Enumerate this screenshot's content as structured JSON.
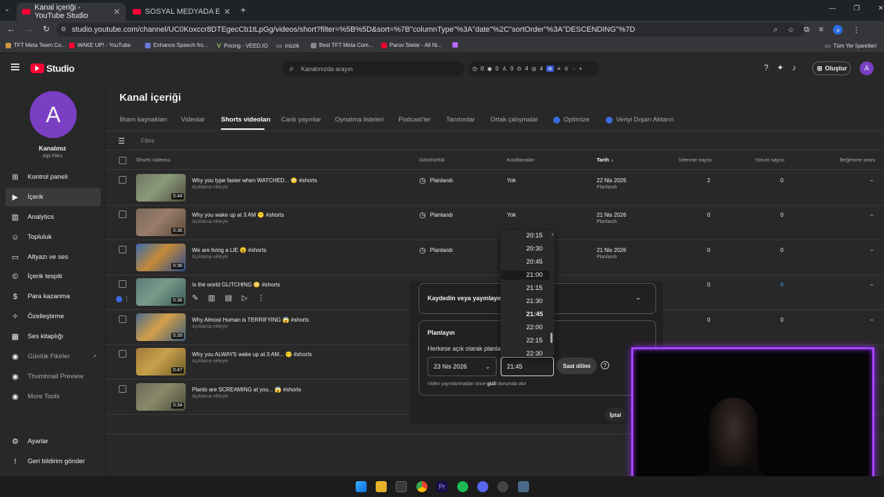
{
  "browser": {
    "tabs": [
      {
        "title": "Kanal içeriği - YouTube Studio"
      },
      {
        "title": "SOSYAL MEDYADA ERKEK OLM..."
      }
    ],
    "url": "studio.youtube.com/channel/UC0Koxccr8DTEgecCb1tLpGg/videos/short?filter=%5B%5D&sort=%7B\"columnType\"%3A\"date\"%2C\"sortOrder\"%3A\"DESCENDING\"%7D",
    "bookmarks": [
      "TFT Meta Team Co...",
      "WAKE UP! - YouTube",
      "Enhance Speech fro...",
      "Pricing - VEED.IO",
      "müzik",
      "Best TFT Meta Com...",
      "Parov Stelar - All Ni..."
    ],
    "all_bookmarks": "Tüm Yer İşaretleri"
  },
  "studio": {
    "logo": "Studio",
    "search_placeholder": "Kanalınızda arayın",
    "create_label": "Oluştur",
    "stats": [
      "0",
      "0",
      "0",
      "4",
      "4"
    ],
    "avatar_letter": "A"
  },
  "channel": {
    "letter": "A",
    "name": "Kanalınız",
    "handle": "Alpi Files"
  },
  "nav": [
    {
      "label": "Kontrol paneli",
      "icon": "dashboard-icon"
    },
    {
      "label": "İçerik",
      "icon": "content-icon"
    },
    {
      "label": "Analytics",
      "icon": "analytics-icon"
    },
    {
      "label": "Topluluk",
      "icon": "community-icon"
    },
    {
      "label": "Altyazı ve ses",
      "icon": "subtitles-icon"
    },
    {
      "label": "İçerik tespiti",
      "icon": "copyright-icon"
    },
    {
      "label": "Para kazanma",
      "icon": "monetization-icon"
    },
    {
      "label": "Özelleştirme",
      "icon": "customization-icon"
    },
    {
      "label": "Ses kitaplığı",
      "icon": "audio-library-icon"
    },
    {
      "label": "Günlük Fikirler",
      "icon": "extension-icon"
    },
    {
      "label": "Thumbnail Preview",
      "icon": "extension-icon"
    },
    {
      "label": "More Tools",
      "icon": "extension-icon"
    }
  ],
  "nav_bottom": [
    {
      "label": "Ayarlar",
      "icon": "settings-icon"
    },
    {
      "label": "Geri bildirim gönder",
      "icon": "feedback-icon"
    }
  ],
  "page_title": "Kanal içeriği",
  "tabs": [
    "İlham kaynakları",
    "Videolar",
    "Shorts videoları",
    "Canlı yayınlar",
    "Oynatma listeleri",
    "Podcast'ler",
    "Tanıtımlar",
    "Ortak çalışmalar",
    "Optimize",
    "Veriyi Dışarı Aktarın"
  ],
  "filter_placeholder": "Filtre",
  "columns": [
    "Shorts videosu",
    "Görünürlük",
    "Kısıtlamalar",
    "Tarih",
    "İzlenme sayısı",
    "Yorum sayısı",
    "Beğenme oranı"
  ],
  "rows": [
    {
      "title": "Why you type faster when WATCHED... 😳 #shorts",
      "desc": "Açıklama ekleyin",
      "dur": "0:44",
      "vis": "Planlandı",
      "restr": "Yok",
      "date": "22 Nis 2026",
      "status": "Planlandı",
      "views": "2",
      "comments": "0",
      "likes": "–"
    },
    {
      "title": "Why you wake up at 3 AM 😶 #shorts",
      "desc": "Açıklama ekleyin",
      "dur": "0:36",
      "vis": "Planlandı",
      "restr": "Yok",
      "date": "21 Nis 2026",
      "status": "Planlandı",
      "views": "0",
      "comments": "0",
      "likes": "–"
    },
    {
      "title": "We are living a LIE 😮 #shorts",
      "desc": "Açıklama ekleyin",
      "dur": "0:36",
      "vis": "Planlandı",
      "restr": "",
      "date": "21 Nis 2026",
      "status": "Planlandı",
      "views": "0",
      "comments": "0",
      "likes": "–"
    },
    {
      "title": "Is the world GLITCHING 😳 #shorts",
      "desc": "",
      "dur": "0:36",
      "vis": "",
      "restr": "",
      "date": "",
      "status": "",
      "views": "0",
      "comments": "0",
      "likes": "–"
    },
    {
      "title": "Why Almost Human is TERRIFYING 😱 #shorts",
      "desc": "Açıklama ekleyin",
      "dur": "0:39",
      "vis": "",
      "restr": "",
      "date": "",
      "status": "",
      "views": "0",
      "comments": "0",
      "likes": "–"
    },
    {
      "title": "Why you ALWAYS wake up at 3 AM... 😶 #shorts",
      "desc": "Açıklama ekleyin",
      "dur": "0:47",
      "vis": "",
      "restr": "",
      "date": "",
      "status": "",
      "views": "",
      "comments": "",
      "likes": ""
    },
    {
      "title": "Plants are SCREAMING at you... 😱 #shorts",
      "desc": "Açıklama ekleyin",
      "dur": "0:34",
      "vis": "",
      "restr": "",
      "date": "",
      "status": "",
      "views": "",
      "comments": "",
      "likes": ""
    }
  ],
  "popup": {
    "save_publish": "Kaydedin veya yayınlayın",
    "schedule_title": "Planlayın",
    "schedule_sub": "Herkese açık olarak planla",
    "date": "23 Nis 2026",
    "time": "21:45",
    "timezone": "Saat dilimi",
    "note_prefix": "Video yayınlanmadan önce ",
    "note_bold": "gizli",
    "note_suffix": " durumda olur",
    "cancel": "İptal"
  },
  "time_options": [
    "20:15",
    "20:30",
    "20:45",
    "21:00",
    "21:15",
    "21:30",
    "21:45",
    "22:00",
    "22:15",
    "22:30"
  ]
}
